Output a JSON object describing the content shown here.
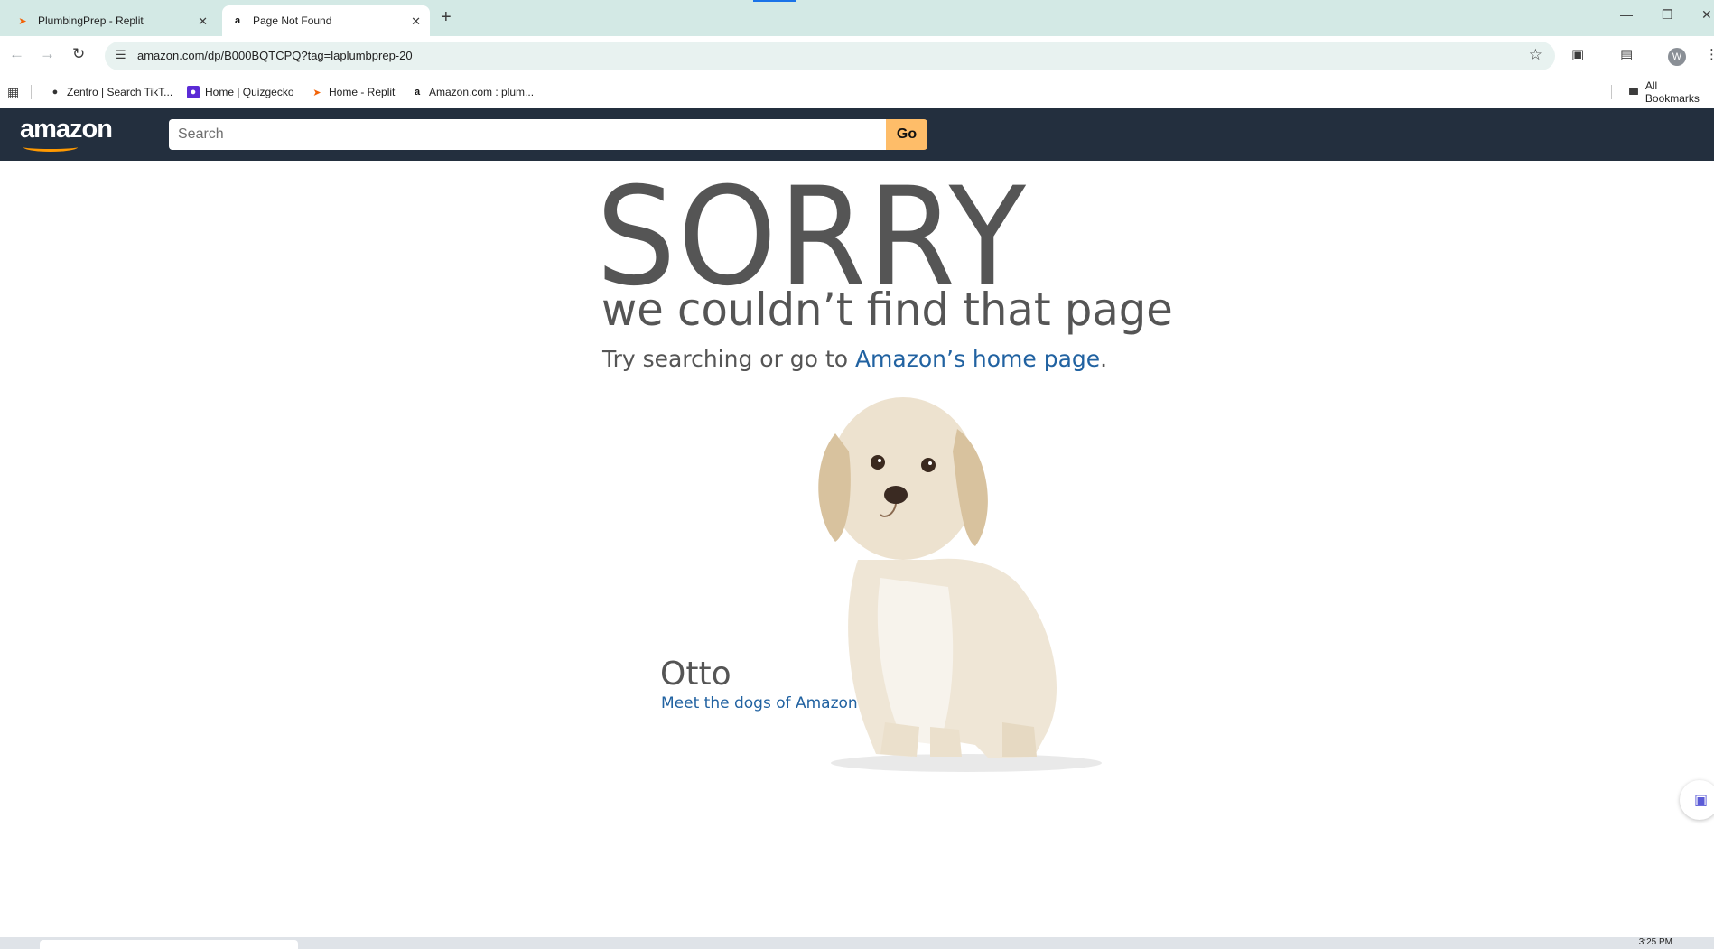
{
  "browser": {
    "tabs": [
      {
        "title": "PlumbingPrep - Replit",
        "icon": "replit-icon",
        "active": false
      },
      {
        "title": "Page Not Found",
        "icon": "amazon-icon",
        "active": true
      }
    ],
    "url": "amazon.com/dp/B000BQTCPQ?tag=laplumbprep-20",
    "profile_initial": "W",
    "bookmarks": [
      {
        "label": "Zentro | Search TikT...",
        "icon": "globe-icon"
      },
      {
        "label": "Home | Quizgecko",
        "icon": "quizgecko-icon"
      },
      {
        "label": "Home - Replit",
        "icon": "replit-icon"
      },
      {
        "label": "Amazon.com : plum...",
        "icon": "amazon-icon"
      }
    ],
    "all_bookmarks_label": "All Bookmarks"
  },
  "amazon": {
    "logo_text": "amazon",
    "search_placeholder": "Search",
    "go_label": "Go"
  },
  "error": {
    "headline": "SORRY",
    "subheadline": "we couldn’t find that page",
    "try_prefix": "Try searching or go to ",
    "home_link": "Amazon’s home page",
    "try_suffix": "."
  },
  "dog": {
    "name": "Otto",
    "link": "Meet the dogs of Amazon"
  },
  "taskbar": {
    "time": "3:25 PM"
  },
  "colors": {
    "tabstrip": "#d3e9e5",
    "amazon_header": "#232f3e",
    "go_button": "#febd69",
    "link": "#2162a1",
    "text": "#555555"
  }
}
